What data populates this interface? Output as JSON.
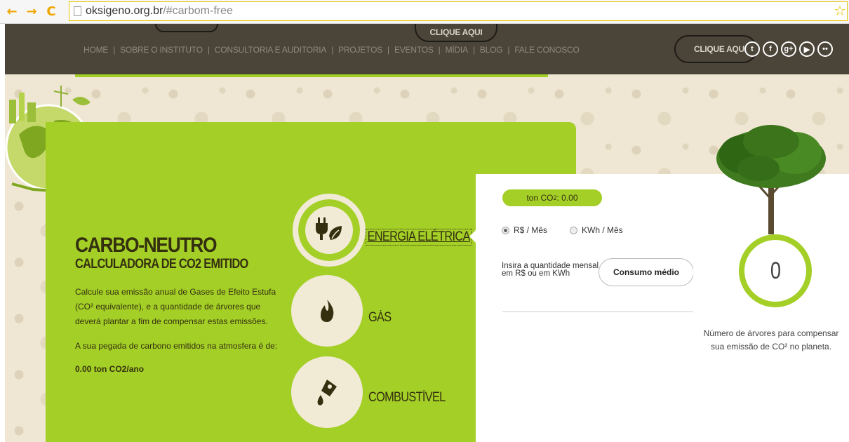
{
  "browser": {
    "url_host": "oksigeno.org.br",
    "url_rest": "/#carbom-free"
  },
  "header": {
    "cta_top": "CLIQUE AQUI",
    "cta_right": "CLIQUE AQUI",
    "nav": [
      "HOME",
      "SOBRE O INSTITUTO",
      "CONSULTORIA E AUDITORIA",
      "PROJETOS",
      "EVENTOS",
      "MÍDIA",
      "BLOG",
      "FALE CONOSCO"
    ],
    "socials": [
      {
        "icon": "twitter-icon",
        "glyph": "t"
      },
      {
        "icon": "facebook-icon",
        "glyph": "f"
      },
      {
        "icon": "googleplus-icon",
        "glyph": "g+"
      },
      {
        "icon": "youtube-icon",
        "glyph": "▶"
      },
      {
        "icon": "flickr-icon",
        "glyph": "••"
      }
    ]
  },
  "calculator": {
    "title": "CARBO-NEUTRO",
    "subtitle": "CALCULADORA DE CO2 EMITIDO",
    "description": "Calcule sua emissão anual de Gases de Efeito Estufa (CO² equivalente), e a quantidade de árvores que deverá plantar a fim de compensar estas emissões.",
    "footprint_label": "A sua pegada de carbono emitidos na atmosfera é de:",
    "footprint_value": "0.00 ton CO2/ano",
    "categories": [
      {
        "label": "ENERGIA ELÉTRICA",
        "icon": "plug-leaf-icon",
        "active": true
      },
      {
        "label": "GÁS",
        "icon": "flame-icon",
        "active": false
      },
      {
        "label": "COMBUSTÍVEL",
        "icon": "fuel-drop-icon",
        "active": false
      }
    ],
    "ton_label": "ton CO",
    "ton_sub": "2",
    "ton_value": ": 0.00",
    "radio_options": [
      {
        "label": "R$ / Mês",
        "checked": true
      },
      {
        "label": "KWh / Mês",
        "checked": false
      }
    ],
    "input_label": "Insira a quantidade mensal em R$ ou em KWh",
    "input_button": "Consumo médio",
    "tree_count": "0",
    "tree_caption": "Número de árvores para compensar sua emissão de CO² no planeta."
  },
  "colors": {
    "accent_green": "#a4cf27",
    "header_bg": "#4a4538",
    "text_dark": "#34300f"
  }
}
